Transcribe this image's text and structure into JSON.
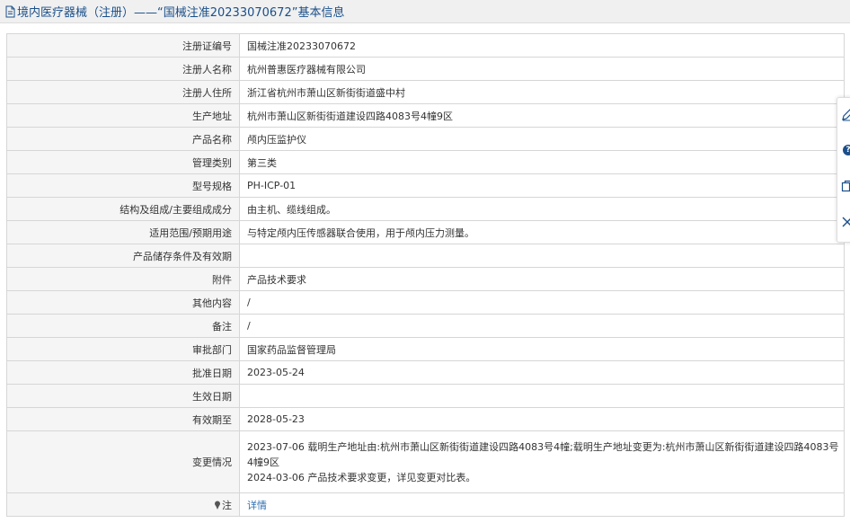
{
  "header": {
    "title": "境内医疗器械（注册）——“国械注准20233070672”基本信息",
    "icon": "document-icon",
    "color": "#1a4f8a"
  },
  "rows": [
    {
      "label": "注册证编号",
      "value": "国械注准20233070672"
    },
    {
      "label": "注册人名称",
      "value": "杭州普惠医疗器械有限公司"
    },
    {
      "label": "注册人住所",
      "value": "浙江省杭州市萧山区新街街道盛中村"
    },
    {
      "label": "生产地址",
      "value": "杭州市萧山区新街街道建设四路4083号4幢9区"
    },
    {
      "label": "产品名称",
      "value": "颅内压监护仪"
    },
    {
      "label": "管理类别",
      "value": "第三类"
    },
    {
      "label": "型号规格",
      "value": "PH-ICP-01"
    },
    {
      "label": "结构及组成/主要组成成分",
      "value": "由主机、缆线组成。"
    },
    {
      "label": "适用范围/预期用途",
      "value": "与特定颅内压传感器联合使用，用于颅内压力测量。"
    },
    {
      "label": "产品储存条件及有效期",
      "value": ""
    },
    {
      "label": "附件",
      "value": "产品技术要求"
    },
    {
      "label": "其他内容",
      "value": "/"
    },
    {
      "label": "备注",
      "value": "/"
    },
    {
      "label": "审批部门",
      "value": "国家药品监督管理局"
    },
    {
      "label": "批准日期",
      "value": "2023-05-24"
    },
    {
      "label": "生效日期",
      "value": ""
    },
    {
      "label": "有效期至",
      "value": "2028-05-23"
    }
  ],
  "changes": {
    "label": "变更情况",
    "lines": [
      "2023-07-06 载明生产地址由:杭州市萧山区新街街道建设四路4083号4幢;载明生产地址变更为:杭州市萧山区新街街道建设四路4083号4幢9区",
      "2024-03-06 产品技术要求变更，详见变更对比表。"
    ]
  },
  "note": {
    "label": "注",
    "icon": "pin-icon",
    "link_text": "详情"
  },
  "toolbar": {
    "help_glyph": "?",
    "icons": [
      "edit-icon",
      "help-icon",
      "copy-icon",
      "close-icon"
    ]
  }
}
